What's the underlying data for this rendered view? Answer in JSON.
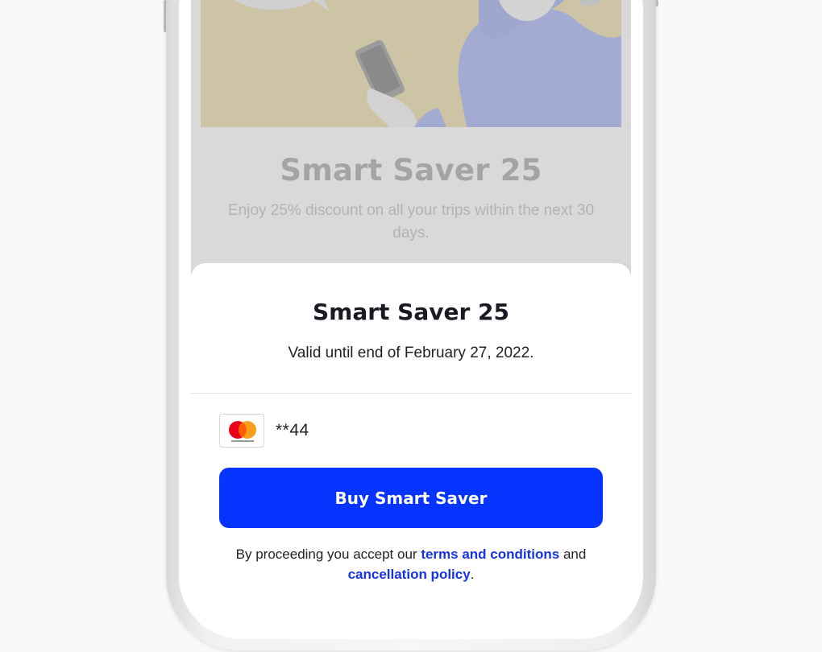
{
  "background_screen": {
    "title": "Smart Saver 25",
    "description": "Enjoy 25% discount on all your trips within the next 30 days."
  },
  "sheet": {
    "title": "Smart Saver 25",
    "subtitle": "Valid until end of February 27, 2022.",
    "payment": {
      "card_brand": "mastercard",
      "card_number": "**44"
    },
    "buy_button_label": "Buy Smart Saver",
    "terms": {
      "prefix": "By proceeding you accept our ",
      "terms_link": "terms and conditions",
      "middle": " and ",
      "cancellation_link": "cancellation policy",
      "suffix": "."
    }
  },
  "colors": {
    "accent": "#0533ff",
    "link": "#1533e6",
    "mastercard_red": "#eb001b",
    "mastercard_orange": "#f79e1b",
    "page_background": "#faf9f7"
  }
}
